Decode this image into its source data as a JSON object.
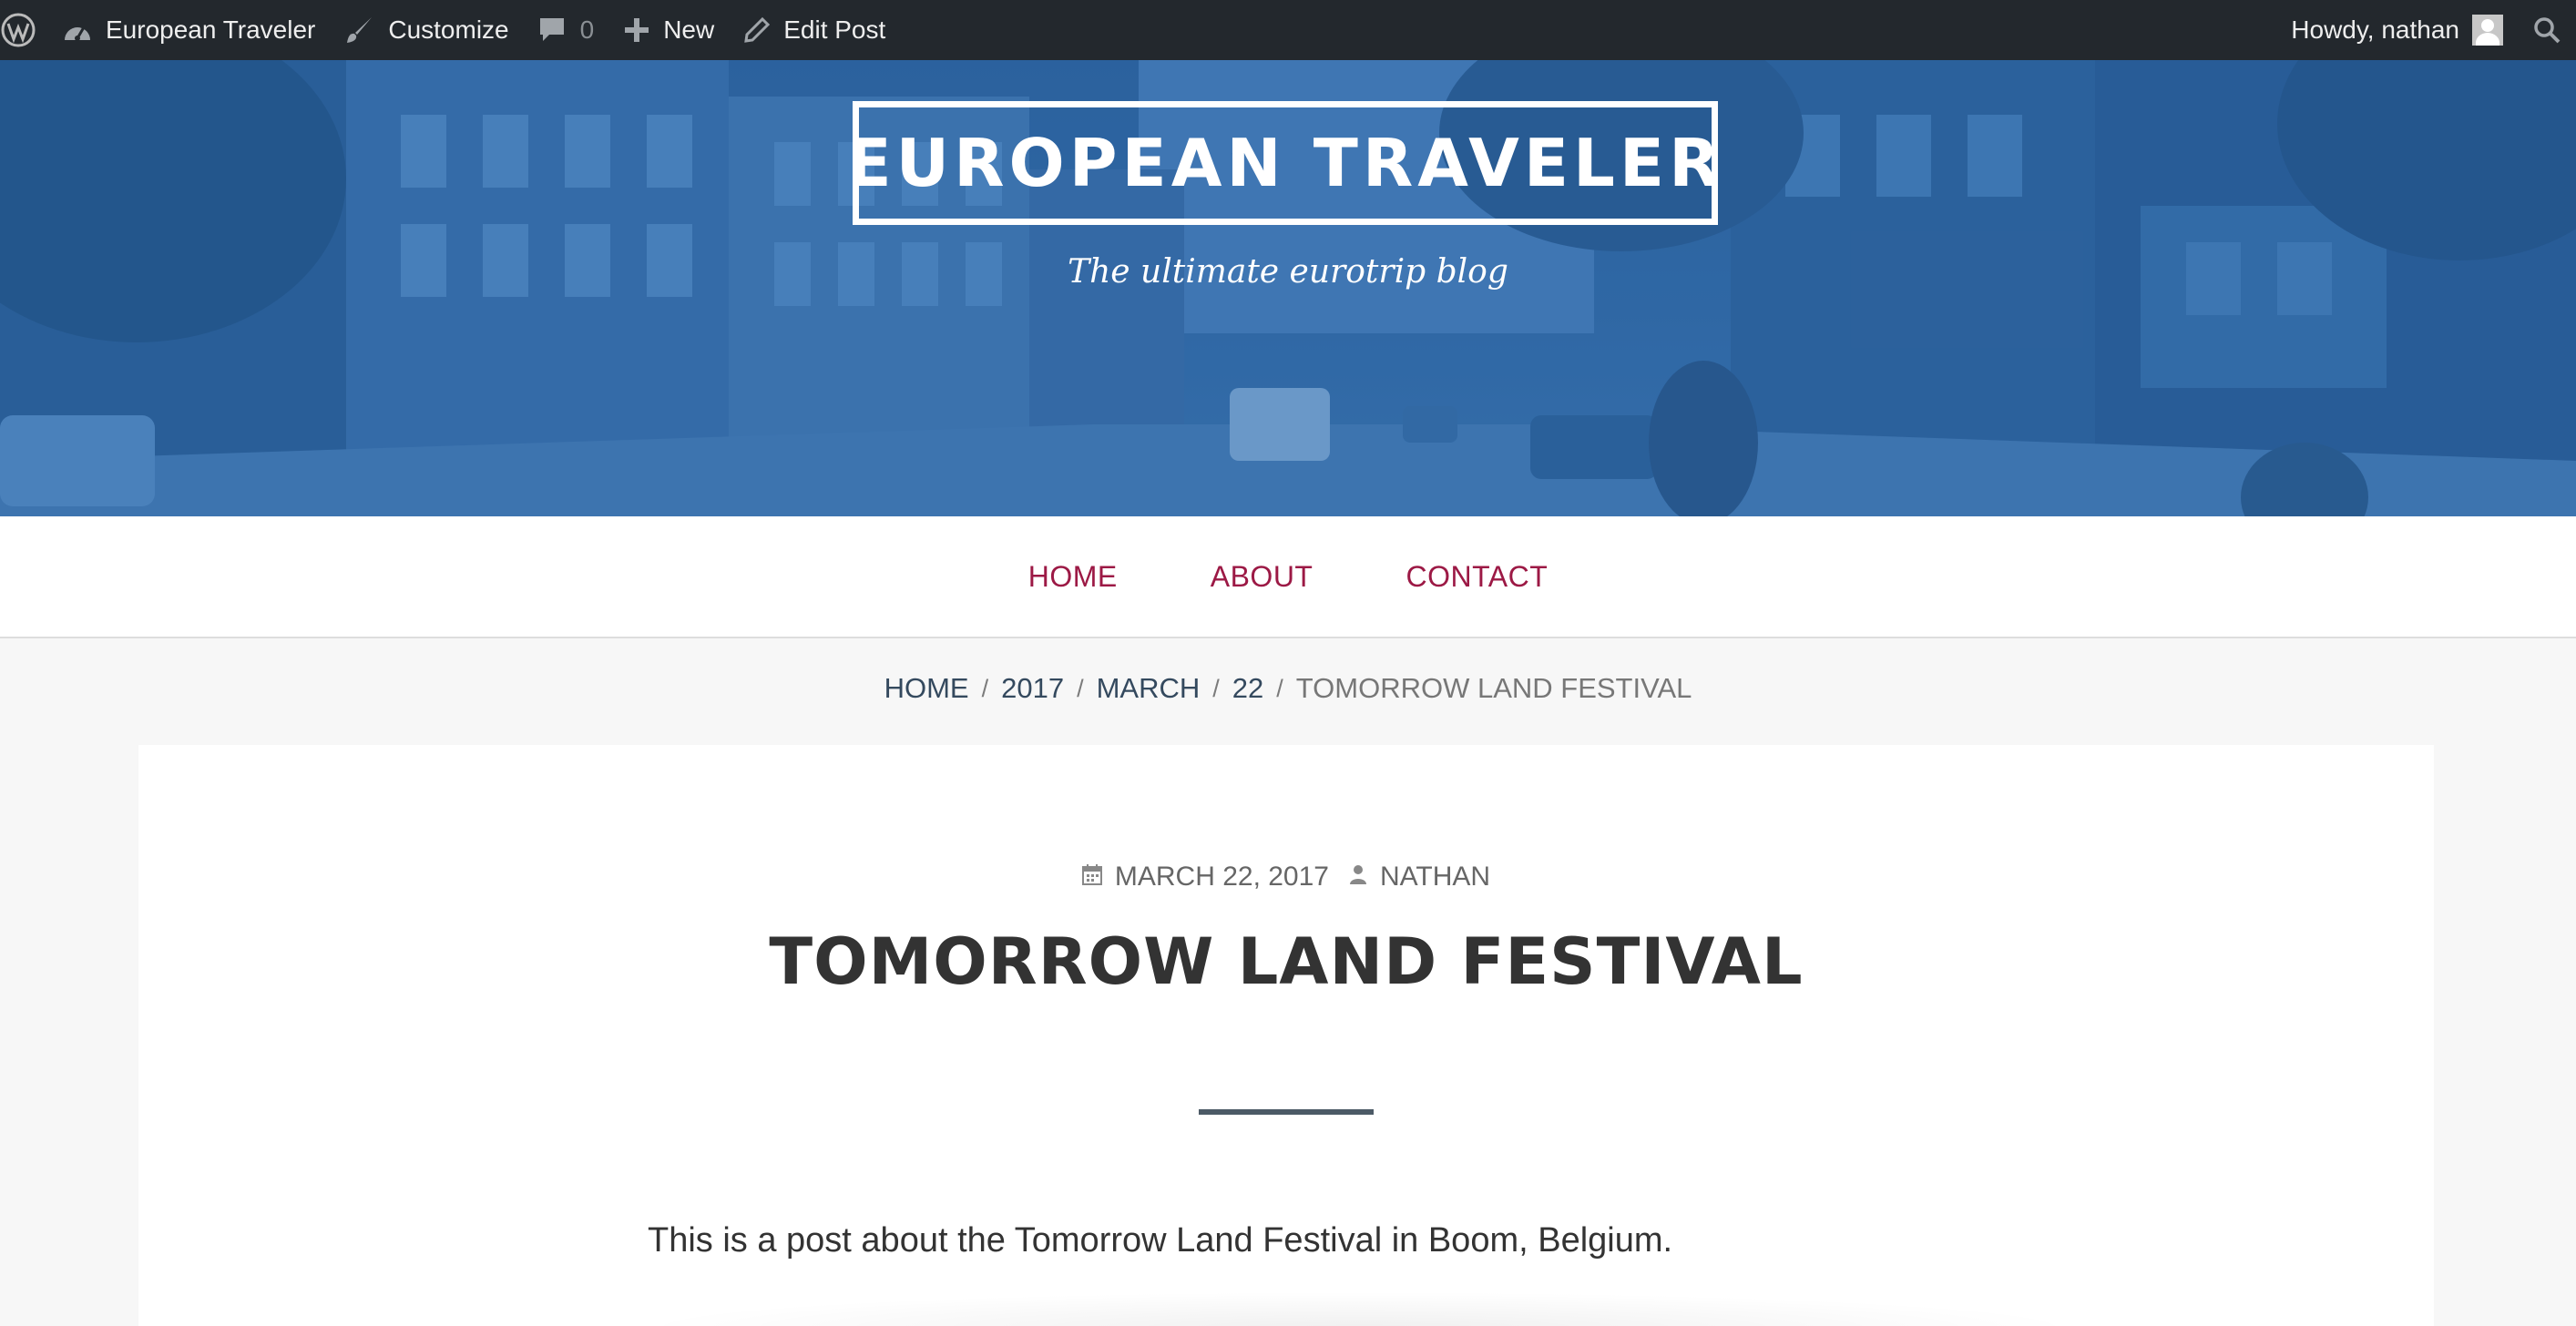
{
  "adminbar": {
    "site_name": "European Traveler",
    "customize_label": "Customize",
    "comments_count": "0",
    "new_label": "New",
    "edit_post_label": "Edit Post",
    "howdy_label": "Howdy, nathan",
    "icons": {
      "wp": "wordpress-logo-icon",
      "site": "dashboard-icon",
      "customize": "paintbrush-icon",
      "comments": "comment-bubble-icon",
      "new": "plus-icon",
      "edit": "pencil-icon",
      "search": "search-icon"
    }
  },
  "header": {
    "site_title": "EUROPEAN TRAVELER",
    "tagline": "The ultimate eurotrip blog"
  },
  "nav": {
    "items": [
      {
        "label": "HOME"
      },
      {
        "label": "ABOUT"
      },
      {
        "label": "CONTACT"
      }
    ]
  },
  "breadcrumb": {
    "items": [
      {
        "label": "HOME"
      },
      {
        "label": "2017"
      },
      {
        "label": "MARCH"
      },
      {
        "label": "22"
      }
    ],
    "current": "TOMORROW LAND FESTIVAL"
  },
  "post": {
    "date": "MARCH 22, 2017",
    "author": "NATHAN",
    "title": "TOMORROW LAND FESTIVAL",
    "body": "This is a post about the Tomorrow Land Festival in Boom, Belgium."
  },
  "colors": {
    "adminbar_bg": "#23282d",
    "nav_link": "#9c1945",
    "breadcrumb_link": "#34495e",
    "hero_overlay": "#2f5f95",
    "divider": "#4c5a66"
  }
}
